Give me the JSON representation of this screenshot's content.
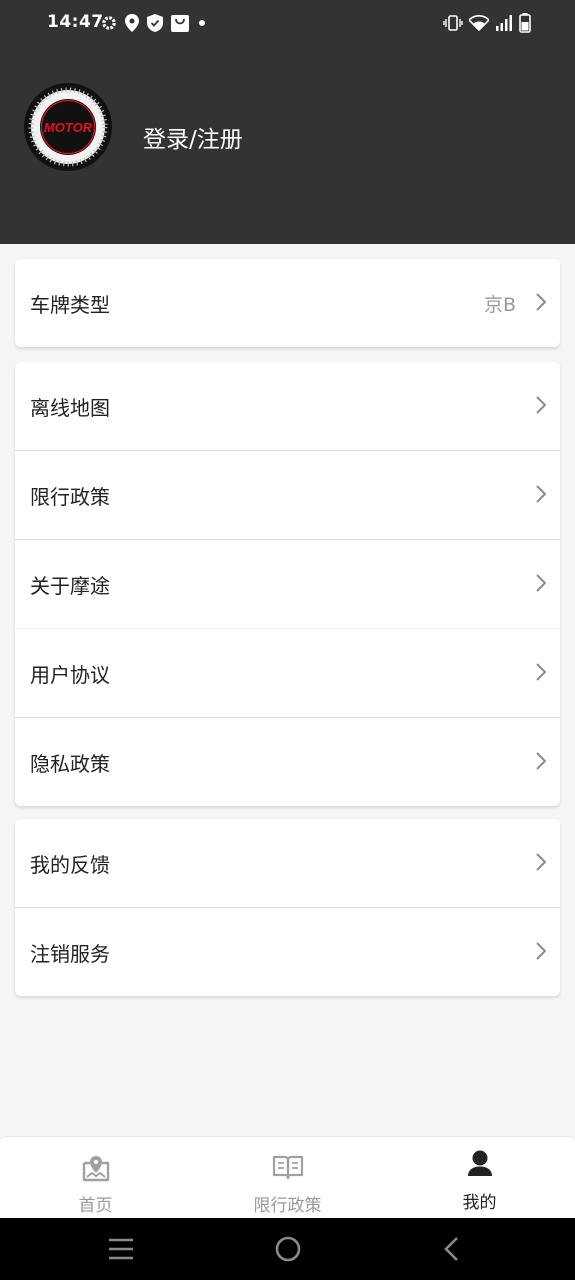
{
  "status_bar": {
    "time": "14:47",
    "left_icons": [
      "gear-icon",
      "location-pin-icon",
      "shield-icon",
      "shopping-bag-icon",
      "dot-icon"
    ],
    "right_icons": [
      "vibrate-icon",
      "wifi-icon",
      "signal-icon",
      "battery-icon"
    ]
  },
  "header": {
    "logo_text": "MOTOR",
    "login_label": "登录/注册",
    "background": "#333333"
  },
  "plate_card": {
    "label": "车牌类型",
    "value": "京B"
  },
  "menu_card": {
    "items": [
      {
        "label": "离线地图"
      },
      {
        "label": "限行政策"
      },
      {
        "label": "关于摩途"
      },
      {
        "label": "用户协议"
      },
      {
        "label": "隐私政策"
      }
    ]
  },
  "service_card": {
    "items": [
      {
        "label": "我的反馈"
      },
      {
        "label": "注销服务"
      }
    ]
  },
  "tabbar": {
    "tabs": [
      {
        "label": "首页",
        "icon": "map-home-icon",
        "active": false
      },
      {
        "label": "限行政策",
        "icon": "book-icon",
        "active": false
      },
      {
        "label": "我的",
        "icon": "person-icon",
        "active": true
      }
    ]
  },
  "colors": {
    "accent_red": "#e0141e",
    "inactive_tab": "#9a9a9a",
    "active_tab": "#222222"
  }
}
